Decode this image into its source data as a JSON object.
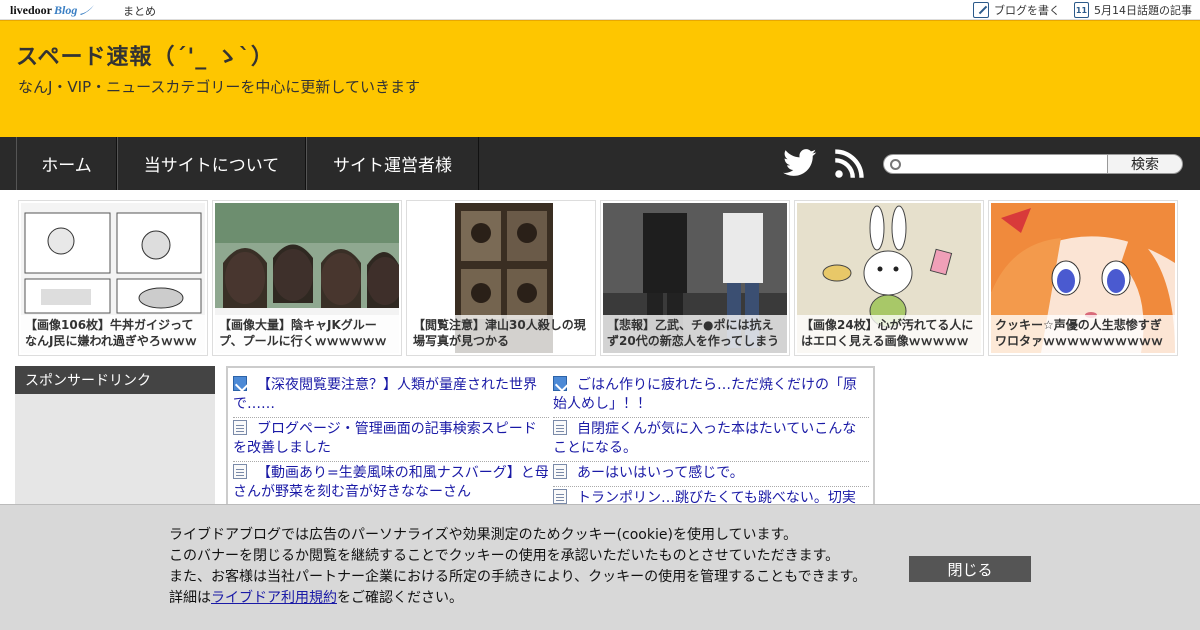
{
  "topbar": {
    "logo_text": "livedoor",
    "logo_blog": "Blog",
    "matome_label": "まとめ",
    "write_blog_label": "ブログを書く",
    "calendar_day": "11",
    "trending_label": "5月14日話題の記事"
  },
  "header": {
    "title": "スペード速報（´'_ ゝ`）",
    "description": "なんJ・VIP・ニュースカテゴリーを中心に更新していきます"
  },
  "nav": {
    "items": [
      {
        "label": "ホーム"
      },
      {
        "label": "当サイトについて"
      },
      {
        "label": "サイト運営者様"
      }
    ],
    "twitter_icon": "twitter-bird-icon",
    "rss_icon": "rss-icon",
    "search_placeholder": "",
    "search_button": "検索"
  },
  "thumbnails": [
    {
      "caption": "【画像106枚】牛丼ガイジってなんJ民に嫌われ過ぎやろｗｗｗｗ"
    },
    {
      "caption": "【画像大量】陰キャJKグループ、プールに行くｗｗｗｗｗｗｗ"
    },
    {
      "caption": "【閲覧注意】津山30人殺しの現場写真が見つかる"
    },
    {
      "caption": "【悲報】乙武、チ●ポには抗えず20代の新恋人を作ってしまう"
    },
    {
      "caption": "【画像24枚】心が汚れてる人にはエロく見える画像ｗｗｗｗｗ"
    },
    {
      "caption": "クッキー☆声優の人生悲惨すぎワロタァｗｗｗｗｗｗｗｗｗｗ"
    }
  ],
  "sidebar": {
    "sponsor_heading": "スポンサードリンク"
  },
  "links": {
    "left": [
      {
        "icon": "pen-icon",
        "text": "【深夜閲覧要注意？】人類が量産された世界で……"
      },
      {
        "icon": "document-icon",
        "text": "ブログページ・管理画面の記事検索スピードを改善しました"
      },
      {
        "icon": "document-icon",
        "text": "【動画あり=生姜風味の和風ナスバーグ】と母さんが野菜を刻む音が好きななーさん"
      }
    ],
    "right": [
      {
        "icon": "pen-icon",
        "text": "ごはん作りに疲れたら…ただ焼くだけの「原始人めし」！！"
      },
      {
        "icon": "document-icon",
        "text": "自閉症くんが気に入った本はたいていこんなことになる。"
      },
      {
        "icon": "document-icon",
        "text": "あーはいはいって感じで。"
      },
      {
        "icon": "document-icon",
        "text": "トランポリン…跳びたくても跳べない。切実"
      }
    ]
  },
  "cookie": {
    "line1": "ライブドアブログでは広告のパーソナライズや効果測定のためクッキー(cookie)を使用しています。",
    "line2": "このバナーを閉じるか閲覧を継続することでクッキーの使用を承認いただいたものとさせていただきます。",
    "line3": "また、お客様は当社パートナー企業における所定の手続きにより、クッキーの使用を管理することもできます。",
    "line4_prefix": "詳細は",
    "line4_link": "ライブドア利用規約",
    "line4_suffix": "をご確認ください。",
    "close_label": "閉じる"
  },
  "colors": {
    "header_bg": "#fec600",
    "nav_bg": "#2a2a2a",
    "link_color": "#1a1aa6",
    "cookie_bg": "#d8d8d8"
  }
}
